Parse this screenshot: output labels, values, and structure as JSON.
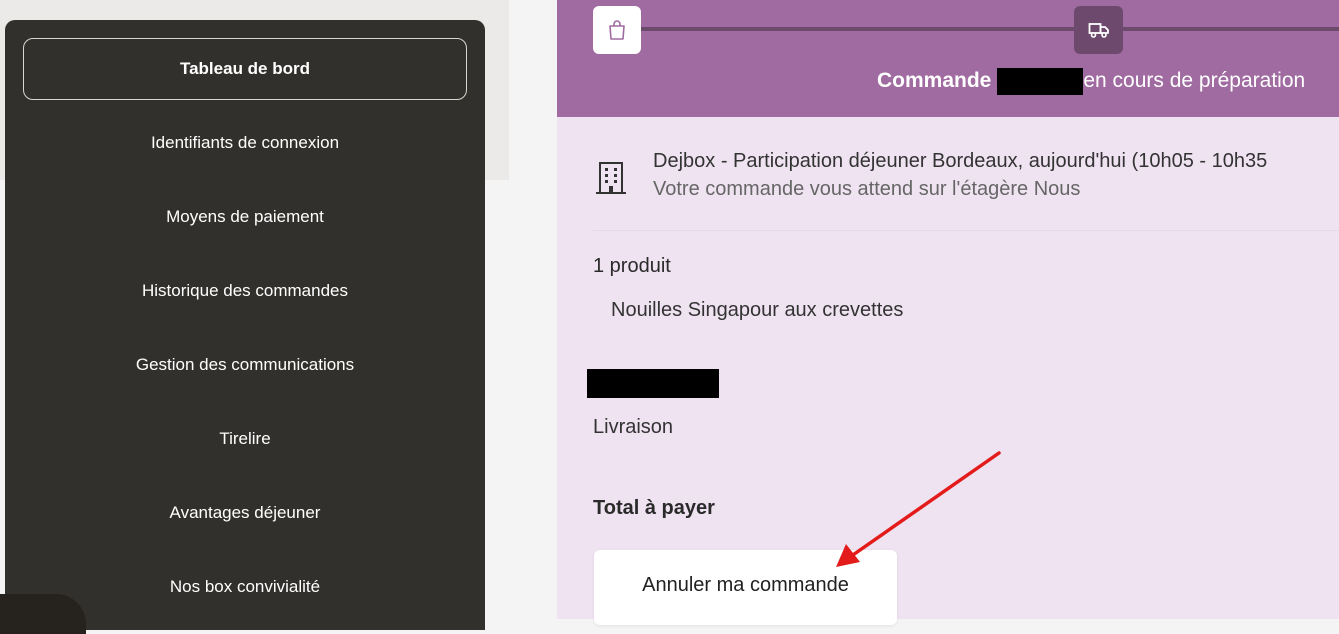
{
  "sidebar": {
    "items": [
      {
        "label": "Tableau de bord",
        "active": true
      },
      {
        "label": "Identifiants de connexion"
      },
      {
        "label": "Moyens de paiement"
      },
      {
        "label": "Historique des commandes"
      },
      {
        "label": "Gestion des communications"
      },
      {
        "label": "Tirelire"
      },
      {
        "label": "Avantages déjeuner"
      },
      {
        "label": "Nos box convivialité"
      }
    ]
  },
  "order": {
    "header_prefix": "Commande",
    "header_suffix": "en cours de préparation",
    "pickup_title": "Dejbox - Participation déjeuner Bordeaux, aujourd'hui (10h05 - 10h35",
    "pickup_subtitle": "Votre commande vous attend sur l'étagère Nous",
    "product_count": "1 produit",
    "product_name": "Nouilles Singapour aux crevettes",
    "delivery_label": "Livraison",
    "total_label": "Total à payer",
    "cancel_label": "Annuler ma commande"
  },
  "icons": {
    "step1": "shopping-bag-icon",
    "step2": "delivery-truck-icon",
    "pickup": "building-icon",
    "annotation": "red-arrow"
  },
  "colors": {
    "sidebar_bg": "#31302c",
    "header_bg": "#a06ba0",
    "content_bg": "#efe3f1",
    "arrow": "#e31b1b"
  }
}
